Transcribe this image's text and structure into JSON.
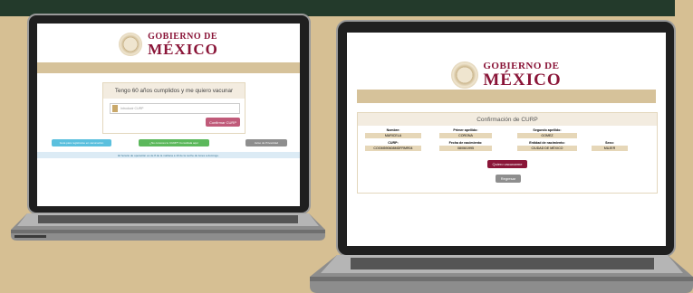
{
  "brand": {
    "line1": "GOBIERNO DE",
    "line2": "MÉXICO"
  },
  "screen1": {
    "panel_title": "Tengo 60 años cumplidos y me quiero vacunar",
    "curp_placeholder": "Introducir CURP",
    "confirm_button": "Confirmar CURP",
    "guide_button": "Guía para registrarse en vacunación",
    "find_curp_button": "¿No conoces tu CURP? Consúltala aquí",
    "privacy_button": "Aviso de Privacidad",
    "hours_notice": "El horario de operación es de 8 de la mañana a 10 de la noche de lunes a domingo."
  },
  "screen2": {
    "title": "Confirmación de CURP",
    "fields": [
      {
        "label": "Nombre:",
        "value": "MARICELA"
      },
      {
        "label": "Primer apellido:",
        "value": "CORONA"
      },
      {
        "label": "Segundo apellido:",
        "value": "GOMEZ"
      },
      {
        "label": "CURP:",
        "value": "COGM590608MDFRMR04"
      },
      {
        "label": "Fecha de nacimiento:",
        "value": "08/06/1995"
      },
      {
        "label": "Entidad de nacimiento:",
        "value": "CIUDAD DE MÉXICO"
      },
      {
        "label": "Sexo:",
        "value": "MUJER"
      }
    ],
    "vaccinate_button": "Quiero vacunarme",
    "back_button": "Regresar"
  },
  "colors": {
    "guinda": "#8a1538",
    "tan": "#d6c29a",
    "blue": "#5bc0de",
    "green": "#5cb85c",
    "gray": "#8e8e8e",
    "background": "#d6bf93",
    "dark_green": "#233a2b"
  }
}
